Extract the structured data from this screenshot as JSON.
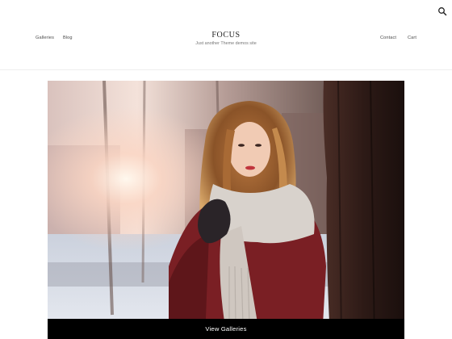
{
  "header": {
    "nav_left": [
      "Galleries",
      "Blog"
    ],
    "site_title": "FOCUS",
    "site_tagline": "Just another Theme demos site",
    "nav_right": [
      "Contact",
      "Cart"
    ]
  },
  "icons": {
    "search": "search-icon"
  },
  "hero": {
    "image": "woman-in-scarf-photo",
    "button_label": "View Galleries"
  },
  "colors": {
    "text_dark": "#222222",
    "nav_text": "#4a4a4a",
    "button_bg": "#000000",
    "button_text": "#ffffff"
  }
}
